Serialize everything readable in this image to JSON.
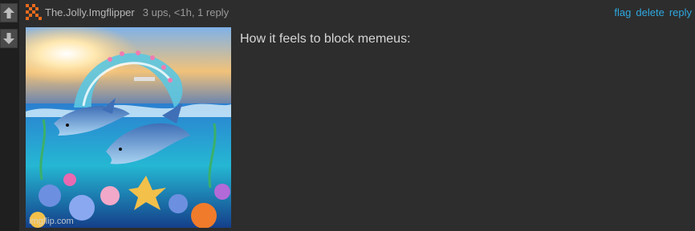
{
  "comment": {
    "username": "The.Jolly.Imgflipper",
    "meta": "3 ups, <1h, 1 reply",
    "text": "How it feels to block memeus:",
    "actions": {
      "flag": "flag",
      "delete": "delete",
      "reply": "reply"
    },
    "image": {
      "description_icon": "dolphins-image",
      "watermark": "imgflip.com"
    }
  },
  "icons": {
    "upvote": "arrow-up-icon",
    "downvote": "arrow-down-icon",
    "avatar": "pixel-avatar-icon"
  },
  "colors": {
    "link": "#2ea8e0",
    "avatar": "#e86a1c",
    "background": "#2d2d2d"
  }
}
